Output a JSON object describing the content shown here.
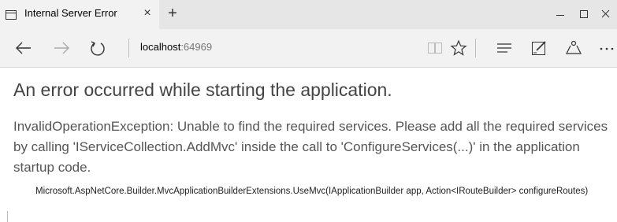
{
  "tab": {
    "title": "Internal Server Error",
    "close": "×",
    "new_tab": "+"
  },
  "address": {
    "host": "localhost",
    "port": ":64969"
  },
  "icons": {
    "page": "page-icon",
    "close": "close-icon",
    "new_tab": "plus-icon",
    "minimize": "minimize-icon",
    "maximize": "maximize-icon",
    "window_close": "close-icon",
    "back": "back-arrow-icon",
    "forward": "forward-arrow-icon",
    "refresh": "refresh-icon",
    "reading_view": "book-icon",
    "favorite": "star-icon",
    "hub": "hub-icon",
    "web_note": "pen-note-icon",
    "share": "share-icon",
    "more": "more-icon"
  },
  "error": {
    "title": "An error occurred while starting the application.",
    "message": "InvalidOperationException: Unable to find the required services. Please add all the required services by calling 'IServiceCollection.AddMvc' inside the call to 'ConfigureServices(...)' in the application startup code.",
    "stack": "Microsoft.AspNetCore.Builder.MvcApplicationBuilderExtensions.UseMvc(IApplicationBuilder app, Action<IRouteBuilder> configureRoutes)"
  }
}
